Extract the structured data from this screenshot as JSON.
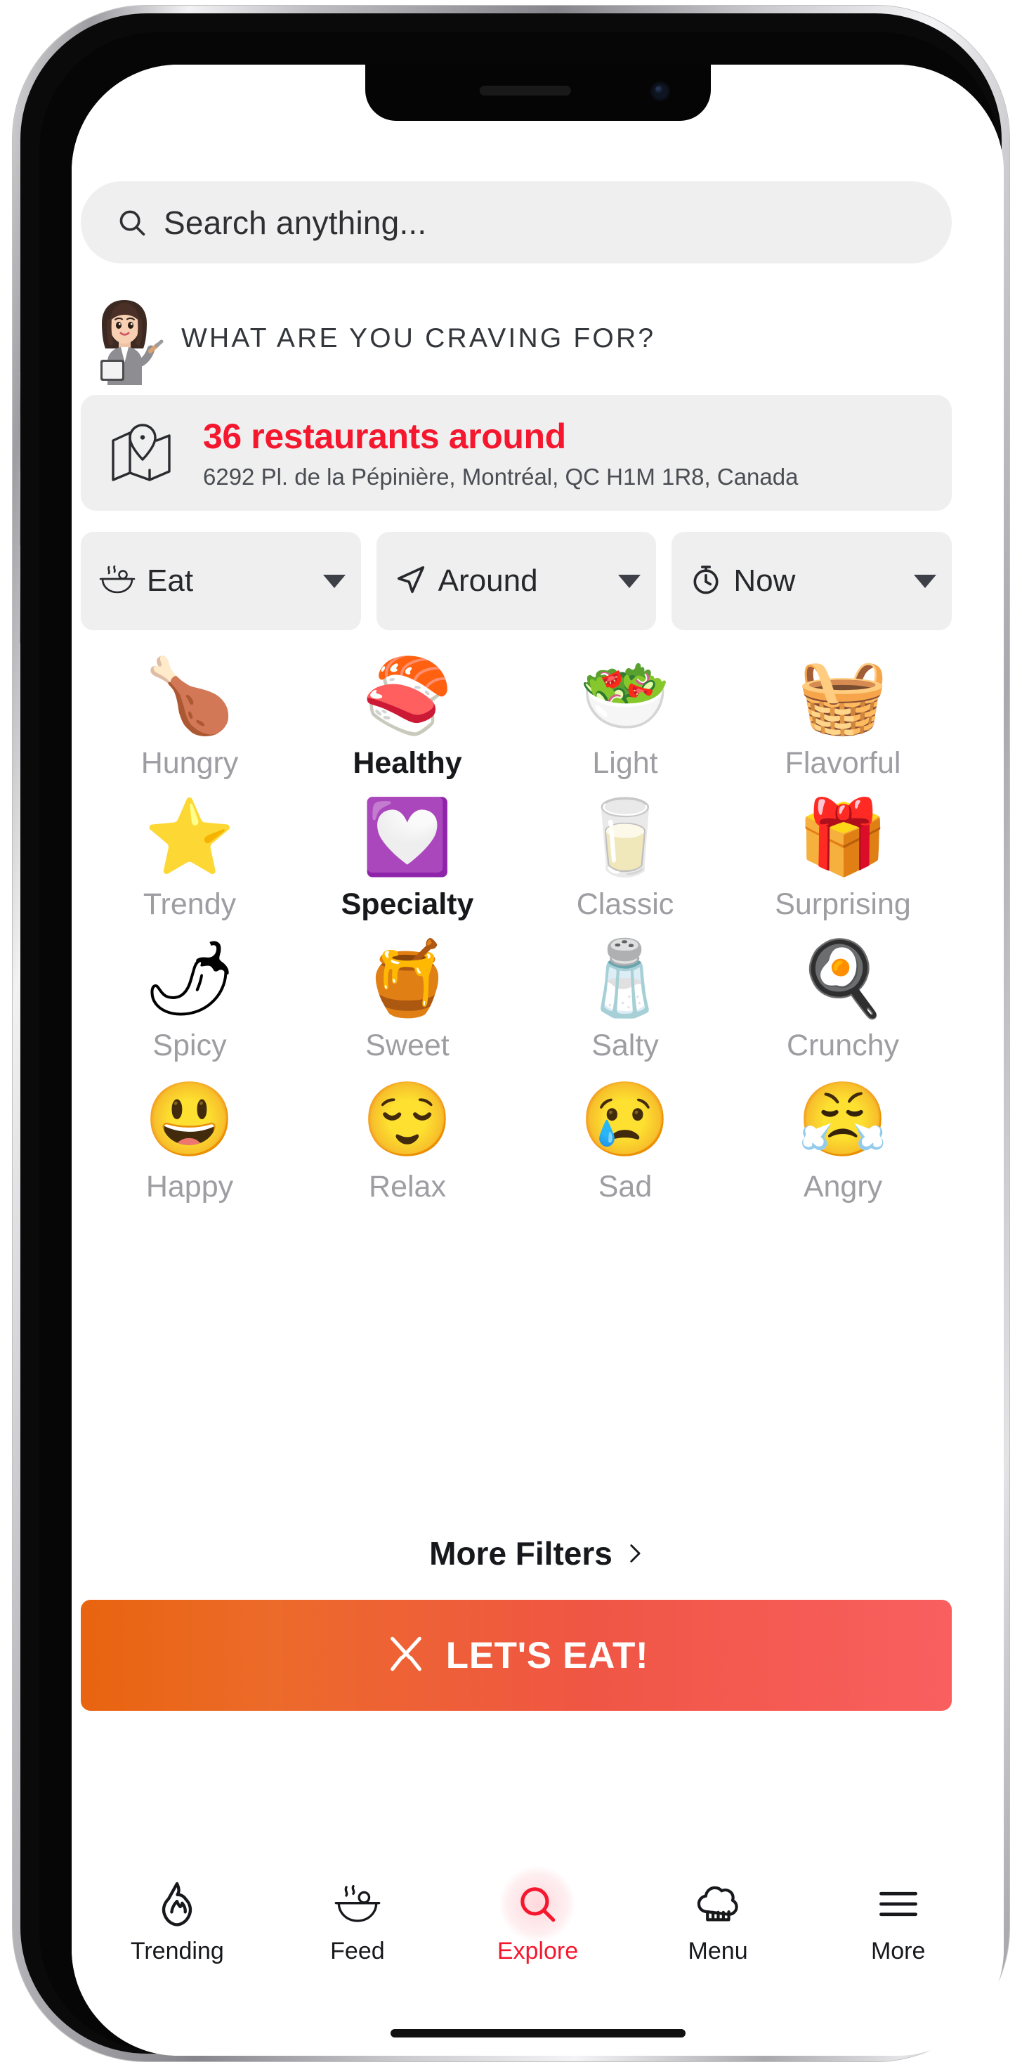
{
  "search": {
    "placeholder": "Search anything...",
    "icon": "search-icon"
  },
  "header": {
    "title": "WHAT ARE YOU CRAVING FOR?",
    "avatar_icon": "woman-with-notebook-avatar"
  },
  "location": {
    "icon": "map-pin-icon",
    "count_text": "36 restaurants around",
    "address": "6292 Pl. de la Pépinière, Montréal, QC H1M 1R8, Canada",
    "accent_color": "#f5172e"
  },
  "filters": [
    {
      "label": "Eat",
      "icon": "steaming-bowl-icon",
      "caret": "chevron-down-icon"
    },
    {
      "label": "Around",
      "icon": "navigation-arrow-icon",
      "caret": "chevron-down-icon"
    },
    {
      "label": "Now",
      "icon": "stopwatch-icon",
      "caret": "chevron-down-icon"
    }
  ],
  "categories": [
    {
      "label": "Hungry",
      "emoji": "🍗",
      "icon": "poultry-leg-icon",
      "selected": false
    },
    {
      "label": "Healthy",
      "emoji": "🍣",
      "icon": "sushi-icon",
      "selected": true
    },
    {
      "label": "Light",
      "emoji": "🥗",
      "icon": "green-salad-icon",
      "selected": false
    },
    {
      "label": "Flavorful",
      "emoji": "🧺",
      "icon": "produce-basket-icon",
      "selected": false
    },
    {
      "label": "Trendy",
      "emoji": "⭐",
      "icon": "star-icon",
      "selected": false
    },
    {
      "label": "Specialty",
      "emoji": "💟",
      "icon": "heart-decoration-icon",
      "selected": true
    },
    {
      "label": "Classic",
      "emoji": "🥛",
      "icon": "milk-carton-icon",
      "selected": false
    },
    {
      "label": "Surprising",
      "emoji": "🎁",
      "icon": "gift-icon",
      "selected": false
    },
    {
      "label": "Spicy",
      "emoji": "🌶",
      "icon": "hot-pepper-icon",
      "selected": false
    },
    {
      "label": "Sweet",
      "emoji": "🍯",
      "icon": "honey-pot-icon",
      "selected": false
    },
    {
      "label": "Salty",
      "emoji": "🧂",
      "icon": "salt-shaker-icon",
      "selected": false
    },
    {
      "label": "Crunchy",
      "emoji": "🍳",
      "icon": "frying-pan-icon",
      "selected": false
    },
    {
      "label": "Happy",
      "emoji": "😃",
      "icon": "smiling-face-icon",
      "selected": false
    },
    {
      "label": "Relax",
      "emoji": "😌",
      "icon": "relieved-face-icon",
      "selected": false
    },
    {
      "label": "Sad",
      "emoji": "😢",
      "icon": "crying-face-icon",
      "selected": false
    },
    {
      "label": "Angry",
      "emoji": "😤",
      "icon": "steam-nose-face-icon",
      "selected": false
    }
  ],
  "more_filters": {
    "label": "More Filters",
    "chevron": "chevron-right-icon"
  },
  "cta": {
    "label": "LET'S EAT!",
    "icon": "fork-and-knife-icon",
    "gradient_from": "#e8640f",
    "gradient_to": "#f95f5f"
  },
  "bottom_nav": [
    {
      "label": "Trending",
      "icon": "flame-icon",
      "active": false
    },
    {
      "label": "Feed",
      "icon": "bowl-icon",
      "active": false
    },
    {
      "label": "Explore",
      "icon": "search-icon",
      "active": true
    },
    {
      "label": "Menu",
      "icon": "chef-hat-icon",
      "active": false
    },
    {
      "label": "More",
      "icon": "hamburger-menu-icon",
      "active": false
    }
  ]
}
